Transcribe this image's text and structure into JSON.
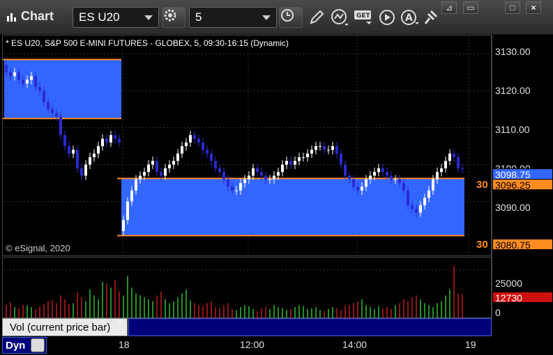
{
  "toolbar": {
    "app_title": "Chart",
    "symbol": "ES U20",
    "interval": "5",
    "icons": [
      "gear-icon",
      "clock-icon",
      "pencil-icon",
      "line-chart-icon",
      "get-icon",
      "play-icon",
      "alert-icon",
      "pin-icon"
    ]
  },
  "window": {
    "buttons": [
      "pin",
      "restore",
      "maximize",
      "close"
    ],
    "close_label": "×"
  },
  "chart": {
    "title": "* ES U20, S&P 500 E-MINI FUTURES - GLOBEX, 5, 09:30-16:15 (Dynamic)",
    "copyright": "© eSignal, 2020",
    "price_ticks": [
      "3130.00",
      "3120.00",
      "3110.00",
      "3100.00",
      "3090.00"
    ],
    "price_tags": {
      "last": "3098.75",
      "level_upper": "3096.25",
      "level_lower": "3080.75",
      "lower_partial": "3080.75"
    },
    "side_labels": {
      "upper": "30",
      "lower": "30"
    },
    "time_ticks": [
      "18",
      "12:00",
      "14:00",
      "19"
    ],
    "colors": {
      "zone": "#3366ff",
      "line": "#ff8c20",
      "up": "#ffffff",
      "down": "#2a2ad0",
      "last_tag": "#3366ff"
    }
  },
  "volume": {
    "label": "Vol (current price bar)",
    "close": "×",
    "ticks": [
      "25000",
      "0"
    ],
    "current_value": "12730",
    "current_color": "#cc1010"
  },
  "footer": {
    "dyn_label": "Dyn"
  },
  "chart_data": {
    "type": "bar",
    "ylim": [
      3075,
      3135
    ],
    "zones": [
      {
        "start": 0,
        "end": 28,
        "low": 3112.5,
        "high": 3128.5
      },
      {
        "start": 28,
        "end": 110,
        "low": 3080.75,
        "high": 3096.25
      }
    ],
    "opens": [
      3127,
      3125,
      3124,
      3125,
      3123,
      3122,
      3123,
      3124,
      3121,
      3120,
      3117,
      3115,
      3114,
      3113,
      3108,
      3105,
      3103,
      3104,
      3099,
      3097,
      3100,
      3102,
      3103,
      3105,
      3107,
      3106,
      3108,
      3107,
      3082,
      3085,
      3090,
      3093,
      3096,
      3097,
      3098,
      3100,
      3101,
      3098,
      3097,
      3099,
      3100,
      3101,
      3103,
      3105,
      3106,
      3108,
      3107,
      3106,
      3104,
      3103,
      3101,
      3099,
      3098,
      3096,
      3094,
      3093,
      3093,
      3095,
      3096,
      3097,
      3099,
      3098,
      3097,
      3096,
      3096,
      3097,
      3098,
      3100,
      3101,
      3100,
      3101,
      3102,
      3102,
      3103,
      3104,
      3105,
      3105,
      3104,
      3104,
      3105,
      3103,
      3100,
      3097,
      3096,
      3094,
      3093,
      3094,
      3096,
      3097,
      3098,
      3099,
      3098,
      3097,
      3096,
      3096,
      3095,
      3093,
      3089,
      3088,
      3087,
      3089,
      3091,
      3093,
      3096,
      3098,
      3099,
      3101,
      3103,
      3102,
      3099
    ],
    "closes": [
      3125,
      3124,
      3125,
      3123,
      3122,
      3123,
      3124,
      3121,
      3120,
      3117,
      3115,
      3114,
      3113,
      3108,
      3105,
      3103,
      3104,
      3099,
      3097,
      3100,
      3102,
      3103,
      3105,
      3107,
      3106,
      3108,
      3107,
      3106,
      3085,
      3090,
      3093,
      3096,
      3097,
      3098,
      3100,
      3101,
      3098,
      3097,
      3099,
      3100,
      3101,
      3103,
      3105,
      3106,
      3108,
      3107,
      3106,
      3104,
      3103,
      3101,
      3099,
      3098,
      3096,
      3094,
      3093,
      3093,
      3095,
      3096,
      3097,
      3099,
      3098,
      3097,
      3096,
      3096,
      3097,
      3098,
      3100,
      3101,
      3100,
      3101,
      3102,
      3102,
      3103,
      3104,
      3105,
      3105,
      3104,
      3104,
      3105,
      3103,
      3100,
      3097,
      3096,
      3094,
      3093,
      3094,
      3096,
      3097,
      3098,
      3099,
      3098,
      3097,
      3096,
      3096,
      3095,
      3093,
      3089,
      3088,
      3087,
      3089,
      3091,
      3093,
      3096,
      3098,
      3099,
      3101,
      3103,
      3102,
      3099,
      3098.75
    ],
    "volumes": [
      7000,
      8500,
      6000,
      5500,
      7200,
      6800,
      6000,
      5000,
      6500,
      7500,
      9000,
      9500,
      8000,
      12000,
      10000,
      7500,
      8000,
      13500,
      11000,
      9000,
      15000,
      12000,
      10000,
      19000,
      18000,
      16000,
      20000,
      14000,
      12000,
      22000,
      16000,
      13000,
      12000,
      11000,
      10000,
      9000,
      12000,
      14000,
      10000,
      8000,
      9000,
      11000,
      13000,
      15000,
      9500,
      8000,
      7000,
      6500,
      8000,
      9000,
      6000,
      5500,
      7000,
      8000,
      5000,
      4500,
      6000,
      7000,
      6500,
      5000,
      4000,
      5500,
      6000,
      5000,
      7000,
      6000,
      5500,
      4500,
      5000,
      6000,
      7000,
      6500,
      5000,
      5500,
      6000,
      4500,
      4000,
      5000,
      6000,
      5500,
      4500,
      6500,
      7000,
      8000,
      9000,
      10000,
      7000,
      6000,
      5000,
      6500,
      5500,
      6000,
      5000,
      7000,
      8000,
      10000,
      9000,
      11000,
      12000,
      10000,
      8000,
      7000,
      6000,
      8000,
      9000,
      12000,
      15000,
      27000,
      13000,
      12730
    ]
  }
}
